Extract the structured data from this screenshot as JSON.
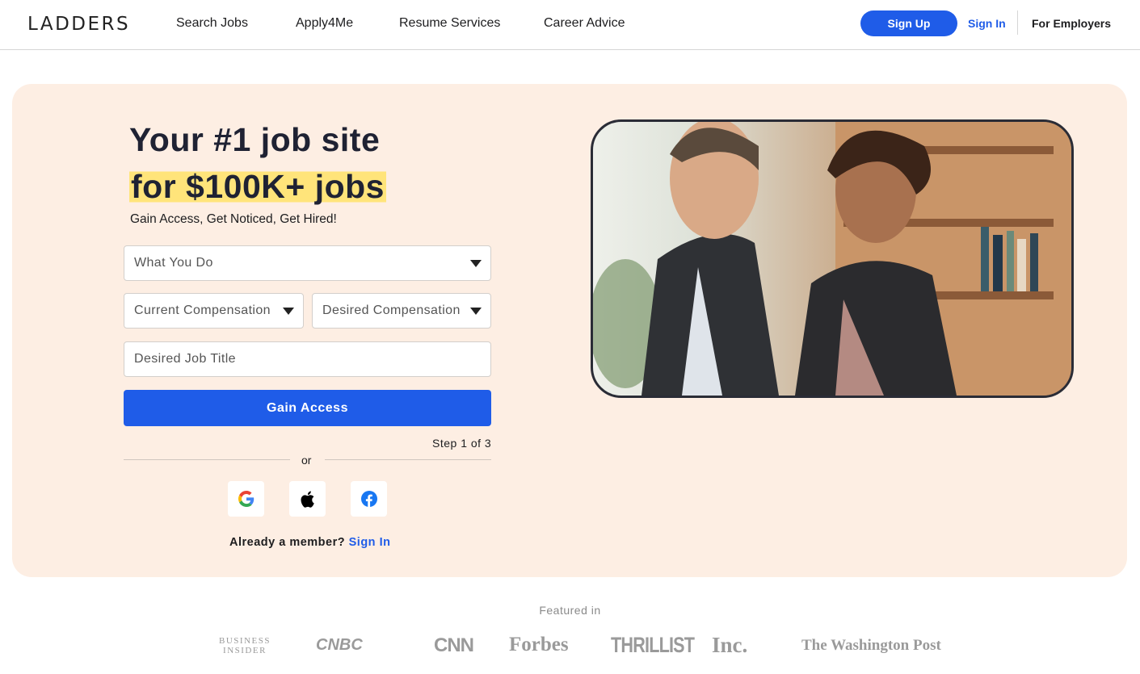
{
  "header": {
    "logo": "LADDERS",
    "nav": [
      "Search Jobs",
      "Apply4Me",
      "Resume Services",
      "Career Advice"
    ],
    "signup_label": "Sign Up",
    "signin_label": "Sign In",
    "employers_label": "For Employers"
  },
  "hero": {
    "headline_line1": "Your #1 job site",
    "headline_line2": "for $100K+ jobs",
    "subheadline": "Gain Access, Get Noticed, Get Hired!",
    "form": {
      "what_you_do_placeholder": "What You Do",
      "current_comp_placeholder": "Current Compensation",
      "desired_comp_placeholder": "Desired Compensation",
      "desired_title_placeholder": "Desired Job Title",
      "submit_label": "Gain Access",
      "step_text": "Step 1 of 3",
      "or_text": "or"
    },
    "social_icons": [
      "google-icon",
      "apple-icon",
      "facebook-icon"
    ],
    "member_text": "Already a member?",
    "member_link": "Sign In"
  },
  "featured": {
    "heading": "Featured in",
    "outlets": [
      "BUSINESS INSIDER",
      "CNBC",
      "CNN",
      "Forbes",
      "THRILLIST",
      "Inc.",
      "The Washington Post"
    ]
  },
  "colors": {
    "accent": "#1f5ce8",
    "hero_bg": "#fdeee3",
    "highlight": "#ffe47a",
    "headline": "#1f2233"
  }
}
